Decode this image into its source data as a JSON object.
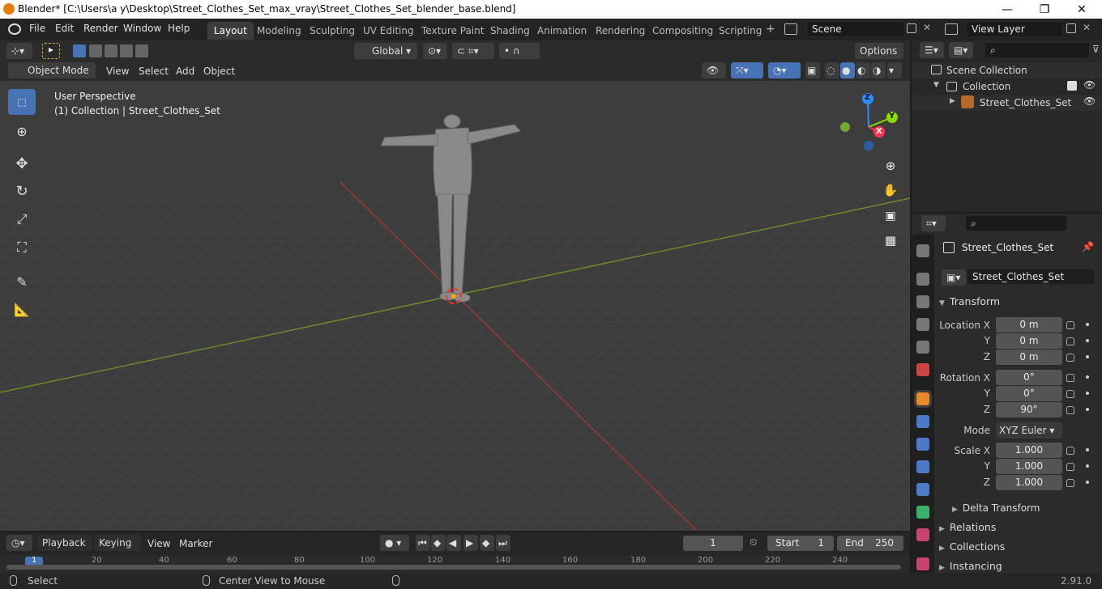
{
  "window": {
    "title": "Blender* [C:\\Users\\a y\\Desktop\\Street_Clothes_Set_max_vray\\Street_Clothes_Set_blender_base.blend]",
    "min": "—",
    "max": "❐",
    "close": "✕"
  },
  "menu": [
    "File",
    "Edit",
    "Render",
    "Window",
    "Help"
  ],
  "workspaces": [
    "Layout",
    "Modeling",
    "Sculpting",
    "UV Editing",
    "Texture Paint",
    "Shading",
    "Animation",
    "Rendering",
    "Compositing",
    "Scripting"
  ],
  "scene": "Scene",
  "view_layer": "View Layer",
  "header": {
    "transform_orientation": "Global",
    "options": "Options",
    "mode": "Object Mode",
    "view": "View",
    "select": "Select",
    "add": "Add",
    "object": "Object"
  },
  "viewport": {
    "perspective": "User Perspective",
    "collection_info": "(1) Collection | Street_Clothes_Set"
  },
  "gizmo": {
    "z": "Z",
    "y": "Y",
    "x": "X"
  },
  "outliner": {
    "scene_collection": "Scene Collection",
    "collection": "Collection",
    "object": "Street_Clothes_Set"
  },
  "properties": {
    "object_name": "Street_Clothes_Set",
    "datablock": "Street_Clothes_Set",
    "transform_title": "Transform",
    "location_x_label": "Location X",
    "y_label": "Y",
    "z_label": "Z",
    "location": [
      "0 m",
      "0 m",
      "0 m"
    ],
    "rotation_x_label": "Rotation X",
    "rotation": [
      "0°",
      "0°",
      "90°"
    ],
    "mode_label": "Mode",
    "mode": "XYZ Euler",
    "scale_x_label": "Scale X",
    "scale": [
      "1.000",
      "1.000",
      "1.000"
    ],
    "delta_transform": "Delta Transform",
    "relations": "Relations",
    "collections": "Collections",
    "instancing": "Instancing"
  },
  "timeline": {
    "playback": "Playback",
    "keying": "Keying",
    "view": "View",
    "marker": "Marker",
    "current_frame": "1",
    "start_label": "Start",
    "start": "1",
    "end_label": "End",
    "end": "250",
    "ruler": [
      "1",
      "20",
      "40",
      "60",
      "80",
      "100",
      "120",
      "140",
      "160",
      "180",
      "200",
      "220",
      "240"
    ]
  },
  "status": {
    "select": "Select",
    "center": "Center View to Mouse",
    "version": "2.91.0"
  },
  "colors": {
    "accent": "#4772b3",
    "x_axis": "#ff3352",
    "y_axis": "#8bdc00",
    "z_axis": "#2890ff"
  }
}
